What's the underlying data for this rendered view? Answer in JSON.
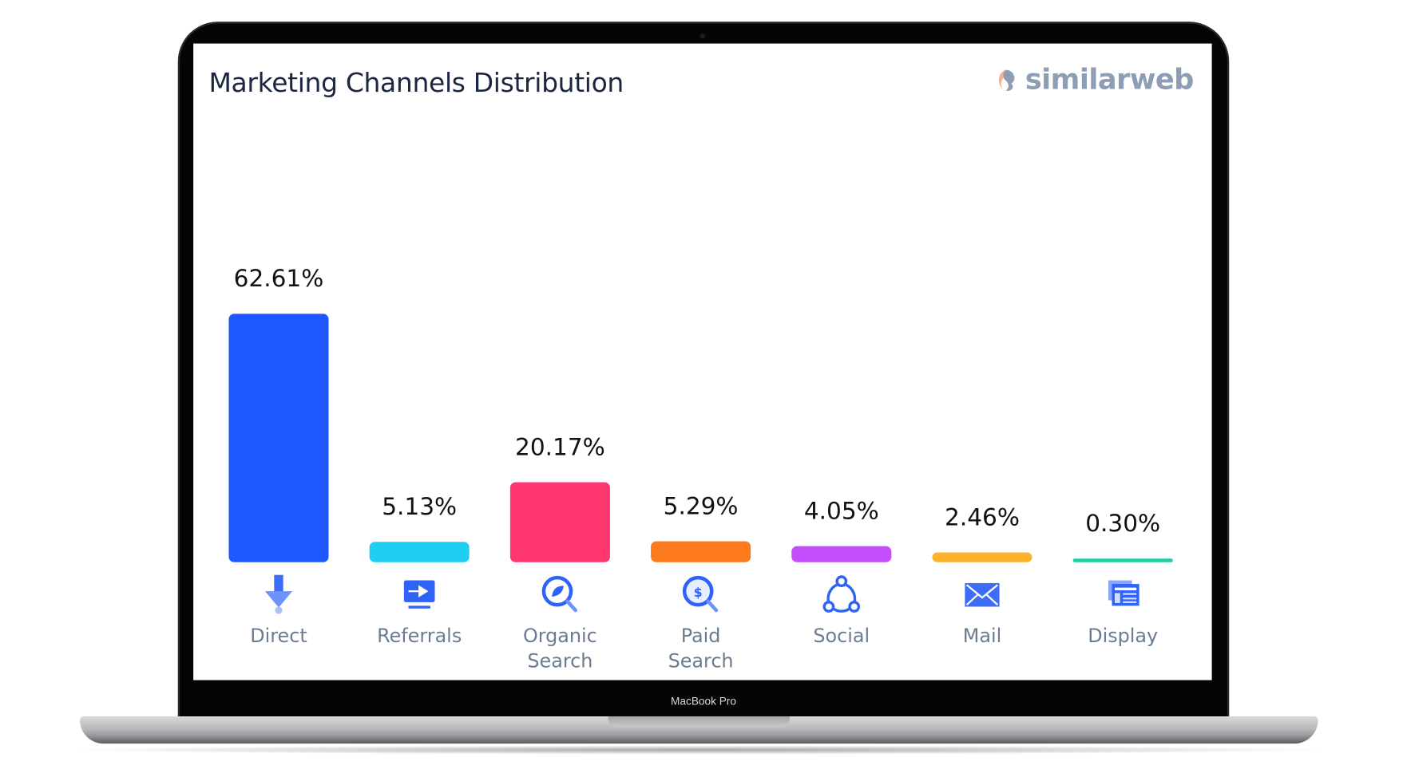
{
  "device": {
    "label": "MacBook Pro"
  },
  "header": {
    "title": "Marketing Channels Distribution",
    "logo_text": "similarweb",
    "logo_colors": {
      "left": "#f2b48a",
      "right": "#8d9db4"
    }
  },
  "chart_data": {
    "type": "bar",
    "title": "Marketing Channels Distribution",
    "xlabel": "",
    "ylabel": "",
    "ylim": [
      0,
      62.61
    ],
    "grid": false,
    "legend": "none",
    "unit": "%",
    "categories": [
      "Direct",
      "Referrals",
      "Organic Search",
      "Paid Search",
      "Social",
      "Mail",
      "Display"
    ],
    "category_lines": [
      [
        "Direct"
      ],
      [
        "Referrals"
      ],
      [
        "Organic",
        "Search"
      ],
      [
        "Paid",
        "Search"
      ],
      [
        "Social"
      ],
      [
        "Mail"
      ],
      [
        "Display"
      ]
    ],
    "values": [
      62.61,
      5.13,
      20.17,
      5.29,
      4.05,
      2.46,
      0.3
    ],
    "value_labels": [
      "62.61%",
      "5.13%",
      "20.17%",
      "5.29%",
      "4.05%",
      "2.46%",
      "0.30%"
    ],
    "colors": [
      "#1f57fe",
      "#1fcff2",
      "#ff3670",
      "#fd7b1c",
      "#c34dfa",
      "#fdb22b",
      "#1ad0a0"
    ],
    "icons": [
      "arrow-down-icon",
      "referral-monitor-icon",
      "organic-search-icon",
      "paid-search-icon",
      "social-share-icon",
      "mail-envelope-icon",
      "display-ad-icon"
    ]
  }
}
